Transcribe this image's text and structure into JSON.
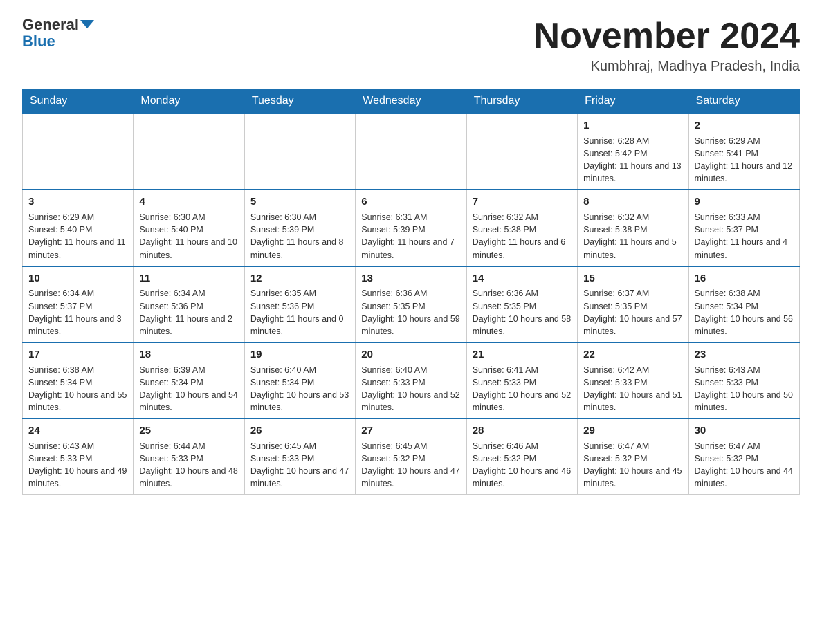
{
  "header": {
    "logo_line1": "General",
    "logo_line2": "Blue",
    "month_title": "November 2024",
    "location": "Kumbhraj, Madhya Pradesh, India"
  },
  "weekdays": [
    "Sunday",
    "Monday",
    "Tuesday",
    "Wednesday",
    "Thursday",
    "Friday",
    "Saturday"
  ],
  "weeks": [
    [
      {
        "day": "",
        "info": ""
      },
      {
        "day": "",
        "info": ""
      },
      {
        "day": "",
        "info": ""
      },
      {
        "day": "",
        "info": ""
      },
      {
        "day": "",
        "info": ""
      },
      {
        "day": "1",
        "info": "Sunrise: 6:28 AM\nSunset: 5:42 PM\nDaylight: 11 hours and 13 minutes."
      },
      {
        "day": "2",
        "info": "Sunrise: 6:29 AM\nSunset: 5:41 PM\nDaylight: 11 hours and 12 minutes."
      }
    ],
    [
      {
        "day": "3",
        "info": "Sunrise: 6:29 AM\nSunset: 5:40 PM\nDaylight: 11 hours and 11 minutes."
      },
      {
        "day": "4",
        "info": "Sunrise: 6:30 AM\nSunset: 5:40 PM\nDaylight: 11 hours and 10 minutes."
      },
      {
        "day": "5",
        "info": "Sunrise: 6:30 AM\nSunset: 5:39 PM\nDaylight: 11 hours and 8 minutes."
      },
      {
        "day": "6",
        "info": "Sunrise: 6:31 AM\nSunset: 5:39 PM\nDaylight: 11 hours and 7 minutes."
      },
      {
        "day": "7",
        "info": "Sunrise: 6:32 AM\nSunset: 5:38 PM\nDaylight: 11 hours and 6 minutes."
      },
      {
        "day": "8",
        "info": "Sunrise: 6:32 AM\nSunset: 5:38 PM\nDaylight: 11 hours and 5 minutes."
      },
      {
        "day": "9",
        "info": "Sunrise: 6:33 AM\nSunset: 5:37 PM\nDaylight: 11 hours and 4 minutes."
      }
    ],
    [
      {
        "day": "10",
        "info": "Sunrise: 6:34 AM\nSunset: 5:37 PM\nDaylight: 11 hours and 3 minutes."
      },
      {
        "day": "11",
        "info": "Sunrise: 6:34 AM\nSunset: 5:36 PM\nDaylight: 11 hours and 2 minutes."
      },
      {
        "day": "12",
        "info": "Sunrise: 6:35 AM\nSunset: 5:36 PM\nDaylight: 11 hours and 0 minutes."
      },
      {
        "day": "13",
        "info": "Sunrise: 6:36 AM\nSunset: 5:35 PM\nDaylight: 10 hours and 59 minutes."
      },
      {
        "day": "14",
        "info": "Sunrise: 6:36 AM\nSunset: 5:35 PM\nDaylight: 10 hours and 58 minutes."
      },
      {
        "day": "15",
        "info": "Sunrise: 6:37 AM\nSunset: 5:35 PM\nDaylight: 10 hours and 57 minutes."
      },
      {
        "day": "16",
        "info": "Sunrise: 6:38 AM\nSunset: 5:34 PM\nDaylight: 10 hours and 56 minutes."
      }
    ],
    [
      {
        "day": "17",
        "info": "Sunrise: 6:38 AM\nSunset: 5:34 PM\nDaylight: 10 hours and 55 minutes."
      },
      {
        "day": "18",
        "info": "Sunrise: 6:39 AM\nSunset: 5:34 PM\nDaylight: 10 hours and 54 minutes."
      },
      {
        "day": "19",
        "info": "Sunrise: 6:40 AM\nSunset: 5:34 PM\nDaylight: 10 hours and 53 minutes."
      },
      {
        "day": "20",
        "info": "Sunrise: 6:40 AM\nSunset: 5:33 PM\nDaylight: 10 hours and 52 minutes."
      },
      {
        "day": "21",
        "info": "Sunrise: 6:41 AM\nSunset: 5:33 PM\nDaylight: 10 hours and 52 minutes."
      },
      {
        "day": "22",
        "info": "Sunrise: 6:42 AM\nSunset: 5:33 PM\nDaylight: 10 hours and 51 minutes."
      },
      {
        "day": "23",
        "info": "Sunrise: 6:43 AM\nSunset: 5:33 PM\nDaylight: 10 hours and 50 minutes."
      }
    ],
    [
      {
        "day": "24",
        "info": "Sunrise: 6:43 AM\nSunset: 5:33 PM\nDaylight: 10 hours and 49 minutes."
      },
      {
        "day": "25",
        "info": "Sunrise: 6:44 AM\nSunset: 5:33 PM\nDaylight: 10 hours and 48 minutes."
      },
      {
        "day": "26",
        "info": "Sunrise: 6:45 AM\nSunset: 5:33 PM\nDaylight: 10 hours and 47 minutes."
      },
      {
        "day": "27",
        "info": "Sunrise: 6:45 AM\nSunset: 5:32 PM\nDaylight: 10 hours and 47 minutes."
      },
      {
        "day": "28",
        "info": "Sunrise: 6:46 AM\nSunset: 5:32 PM\nDaylight: 10 hours and 46 minutes."
      },
      {
        "day": "29",
        "info": "Sunrise: 6:47 AM\nSunset: 5:32 PM\nDaylight: 10 hours and 45 minutes."
      },
      {
        "day": "30",
        "info": "Sunrise: 6:47 AM\nSunset: 5:32 PM\nDaylight: 10 hours and 44 minutes."
      }
    ]
  ]
}
